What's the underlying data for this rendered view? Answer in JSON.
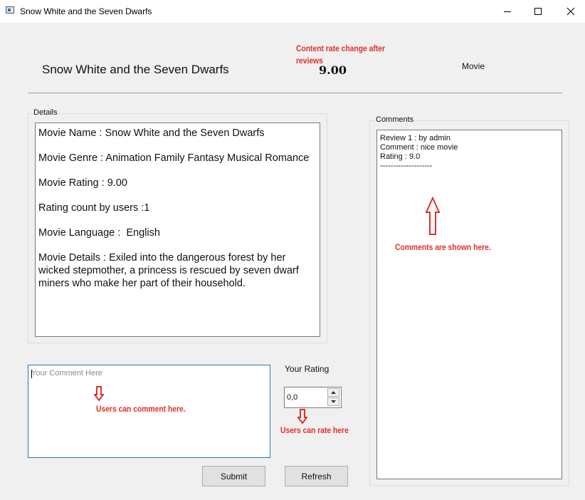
{
  "window": {
    "title": "Snow White and the Seven Dwarfs"
  },
  "header": {
    "movie_title": "Snow White and the Seven Dwarfs",
    "rating": "9.00",
    "type": "Movie"
  },
  "details": {
    "group_label": "Details",
    "lines": [
      "Movie Name : Snow White and the Seven Dwarfs",
      "Movie Genre : Animation Family Fantasy Musical Romance",
      "Movie Rating : 9.00",
      "Rating count by users :1",
      "Movie Language :  English",
      "Movie Details : Exiled into the dangerous forest by her wicked stepmother, a princess is rescued by seven dwarf miners who make her part of their household."
    ]
  },
  "comments": {
    "group_label": "Comments",
    "lines": [
      "Review 1 : by admin",
      "Comment : nice movie",
      "Rating : 9.0",
      "--------------------"
    ]
  },
  "comment_input": {
    "placeholder": "Your Comment Here",
    "value": ""
  },
  "rating_input": {
    "label": "Your Rating",
    "value": "0,0"
  },
  "buttons": {
    "submit": "Submit",
    "refresh": "Refresh"
  },
  "annotations": {
    "content_rate_line1": "Content rate change after",
    "content_rate_line2": "reviews",
    "comments_shown": "Comments are shown here.",
    "users_comment": "Users can comment here.",
    "users_rate": "Users can rate here"
  },
  "colors": {
    "annotation": "#e0302b",
    "focus_border": "#2b78b9",
    "background": "#f0f0f0"
  },
  "icons": {
    "app": "window-app-icon",
    "minimize": "minimize-icon",
    "maximize": "maximize-icon",
    "close": "close-icon",
    "spin_up": "triangle-up-icon",
    "spin_down": "triangle-down-icon",
    "arrow_up": "red-arrow-up-icon",
    "arrow_down": "red-arrow-down-icon"
  }
}
